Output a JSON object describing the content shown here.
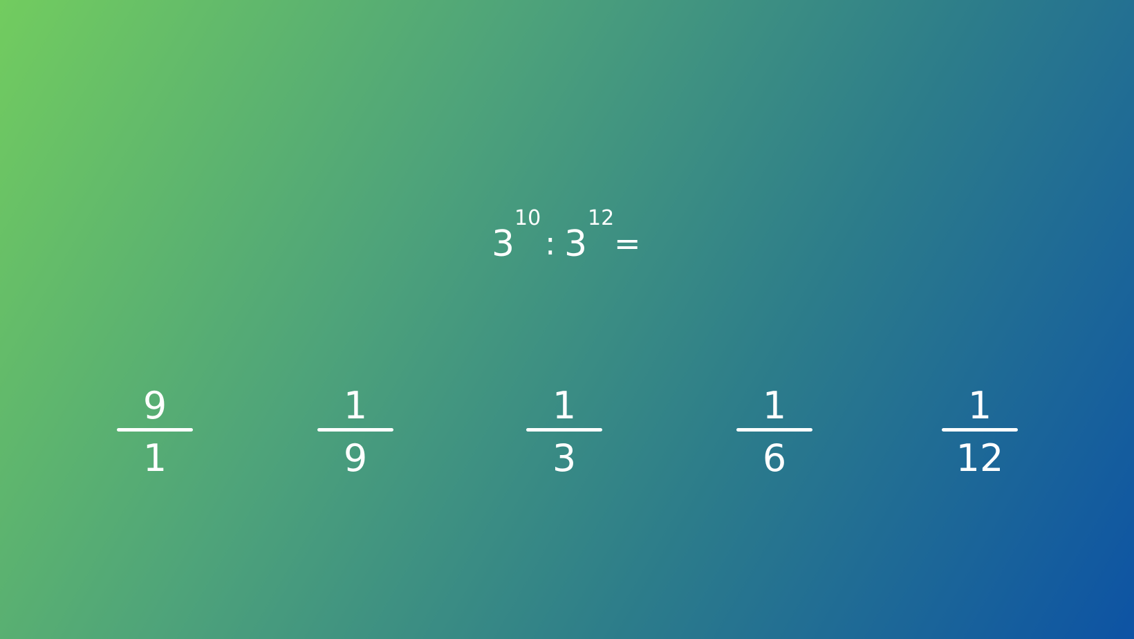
{
  "question": {
    "base1": "3",
    "exp1": "10",
    "operator": ":",
    "base2": "3",
    "exp2": "12",
    "equals": "="
  },
  "answers": [
    {
      "numerator": "9",
      "denominator": "1"
    },
    {
      "numerator": "1",
      "denominator": "9"
    },
    {
      "numerator": "1",
      "denominator": "3"
    },
    {
      "numerator": "1",
      "denominator": "6"
    },
    {
      "numerator": "1",
      "denominator": "12"
    }
  ],
  "colors": {
    "gradient_top_left": "#72cc5f",
    "gradient_bottom_right": "#0d53a4",
    "text": "#ffffff"
  }
}
